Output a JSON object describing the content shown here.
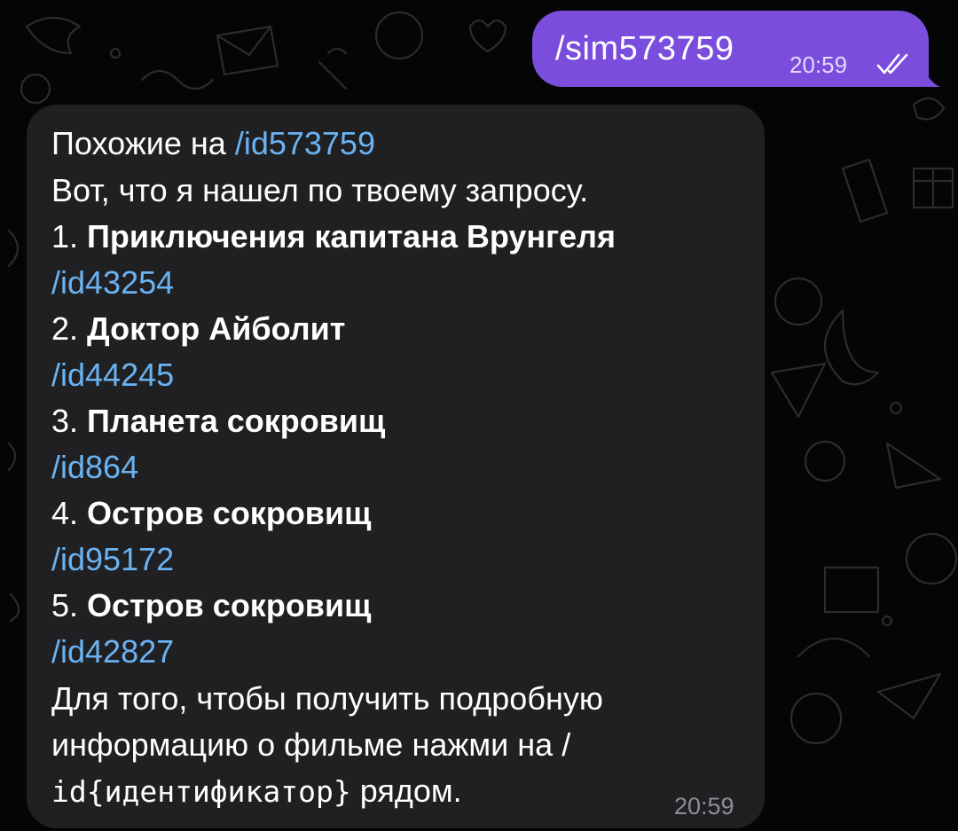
{
  "outgoing": {
    "text": "/sim573759",
    "time": "20:59"
  },
  "incoming": {
    "line1_prefix": "Похожие на ",
    "line1_link": "/id573759",
    "line2": "Вот, что я нашел по твоему запросу.",
    "items": [
      {
        "num": "1. ",
        "title": "Приключения капитана Врунгеля",
        "link": "/id43254"
      },
      {
        "num": "2. ",
        "title": "Доктор Айболит",
        "link": "/id44245"
      },
      {
        "num": "3. ",
        "title": "Планета сокровищ",
        "link": "/id864"
      },
      {
        "num": "4. ",
        "title": "Остров сокровищ",
        "link": "/id95172"
      },
      {
        "num": "5. ",
        "title": "Остров сокровищ",
        "link": "/id42827"
      }
    ],
    "footer_line1": "Для того, чтобы получить подробную",
    "footer_line2": "информацию о фильме нажми на /",
    "footer_code": "id{идентификатор}",
    "footer_tail": " рядом.",
    "time": "20:59"
  },
  "colors": {
    "background": "#050506",
    "outgoing_bubble": "#7a4ddc",
    "incoming_bubble": "#202023",
    "link": "#6ab3f3"
  }
}
